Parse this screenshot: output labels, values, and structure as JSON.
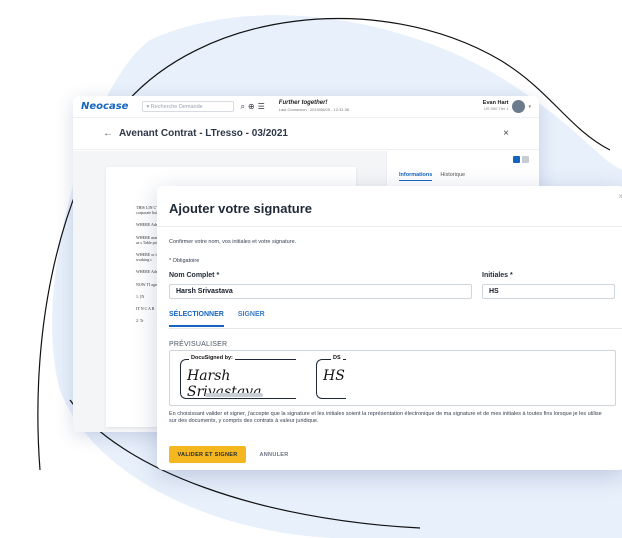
{
  "colors": {
    "accent": "#1565c0",
    "primary_button": "#f5b71f",
    "blob": "#e8f0fb"
  },
  "app": {
    "logo": "Neocase",
    "search_placeholder": "▾ Recherche Demande",
    "tagline": "Further together!",
    "last_connection": "Last Connexion : 2019/06/09 - 12:31:36",
    "user_name": "Evan Hart",
    "user_sub": "US 900 Tier 1"
  },
  "document": {
    "title": "Avenant Contrat - LTresso - 03/2021",
    "back_icon": "←",
    "close_icon": "×",
    "lines": [
      "THIS LIN C'Agreem corporate both of w",
      "WHERE Adminis",
      "WHERE manager who, as s Table pri",
      "WHERE or the \"R working c",
      "WHERE Adminis",
      "NOW TI agree as f",
      "1. [N",
      "IT N C A R",
      "2. Tr"
    ]
  },
  "side_panel": {
    "tabs": [
      "Informations",
      "Historique"
    ]
  },
  "modal": {
    "title": "Ajouter votre signature",
    "close_icon": "×",
    "confirm_text": "Confirmer votre nom, vos initiales et votre signature.",
    "required_text": "* Obligatoire",
    "full_name_label": "Nom Complet *",
    "full_name_value": "Harsh Srivastava",
    "initials_label": "Initiales *",
    "initials_value": "HS",
    "tabs": [
      "SÉLECTIONNER",
      "SIGNER"
    ],
    "preview_label": "PRÉVISUALISER",
    "signature_frame_title": "DocuSigned by:",
    "signature_script": "Harsh Srivastava",
    "initials_frame_title": "DS",
    "initials_script": "HS",
    "legal_text": "En choisissant valider et signer, j'accepte que la signature et les initiales soient la représentation électronique de ma signature et de mes initiales à toutes fins lorsque je les utilise sur des documents, y compris des contrats à valeur juridique.",
    "primary_button": "VALIDER ET SIGNER",
    "secondary_button": "ANNULER"
  }
}
